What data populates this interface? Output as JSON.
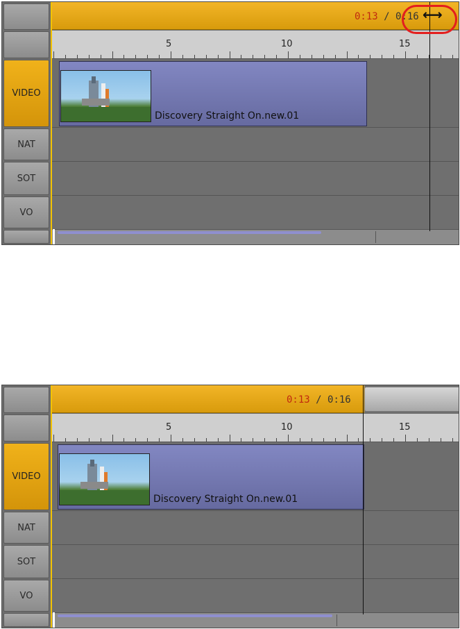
{
  "panels": [
    {
      "timecode": {
        "current": "0:13",
        "separator": " / ",
        "total": "0:16"
      },
      "ruler_marks": [
        "5",
        "10",
        "15"
      ],
      "tracks": [
        "VIDEO",
        "NAT",
        "SOT",
        "VO"
      ],
      "clip": {
        "name": "Discovery Straight On.new.01"
      },
      "cursor_icon": "resize-horizontal-icon"
    },
    {
      "timecode": {
        "current": "0:13",
        "separator": " / ",
        "total": "0:16"
      },
      "ruler_marks": [
        "5",
        "10",
        "15"
      ],
      "tracks": [
        "VIDEO",
        "NAT",
        "SOT",
        "VO"
      ],
      "clip": {
        "name": "Discovery Straight On.new.01"
      }
    }
  ],
  "colors": {
    "duration_bar": "#f0a800",
    "clip": "#7a7fbe",
    "highlight_circle": "#e31e1e",
    "current_time": "#c0290f"
  }
}
